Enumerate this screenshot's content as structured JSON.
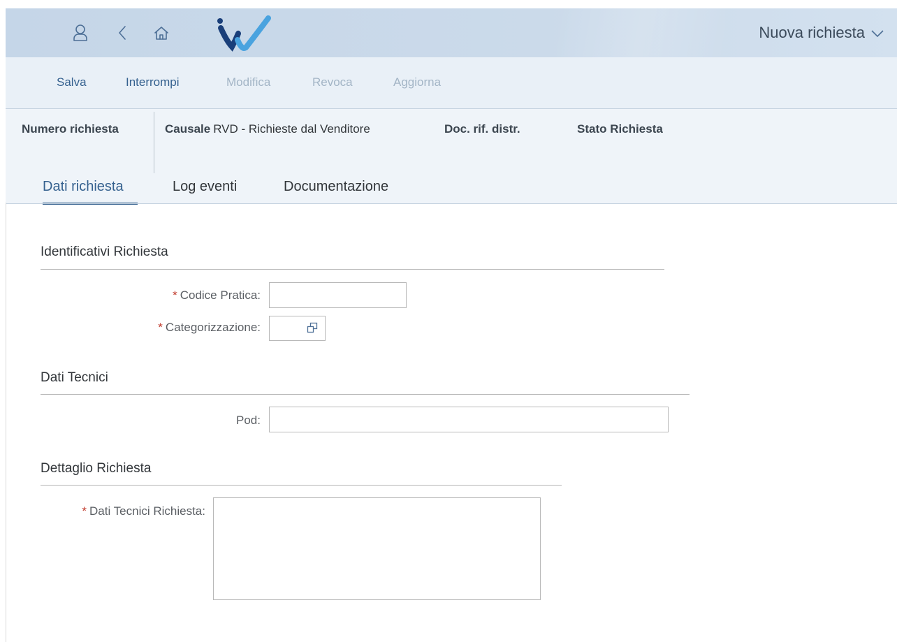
{
  "header": {
    "app_title": "Nuova richiesta",
    "icons": [
      "user-icon",
      "back-icon",
      "home-icon",
      "company-logo",
      "chevron-down-icon"
    ],
    "colors": {
      "shell_bg": "#c9d9ea",
      "icon": "#4d6f96",
      "logo_dark": "#1a3f7a",
      "logo_light": "#4aa3df"
    }
  },
  "toolbar": {
    "save": "Salva",
    "interrupt": "Interrompi",
    "edit": "Modifica",
    "revoke": "Revoca",
    "refresh": "Aggiorna",
    "colors": {
      "enabled": "#35618f",
      "disabled": "#a3b5c6"
    }
  },
  "object_header": {
    "request_number_label": "Numero richiesta",
    "cause_label": "Causale",
    "cause_value": "RVD - Richieste dal Venditore",
    "doc_ref_label": "Doc. rif. distr.",
    "status_label": "Stato Richiesta"
  },
  "tabs": [
    {
      "label": "Dati richiesta",
      "selected": true
    },
    {
      "label": "Log eventi",
      "selected": false
    },
    {
      "label": "Documentazione",
      "selected": false
    }
  ],
  "form": {
    "required_marker": "*",
    "sections": {
      "identifiers": {
        "title": "Identificativi Richiesta",
        "codice_pratica": {
          "label": "Codice Pratica:",
          "value": ""
        },
        "categorizzazione": {
          "label": "Categorizzazione:",
          "value": ""
        }
      },
      "technical": {
        "title": "Dati Tecnici",
        "pod": {
          "label": "Pod:",
          "value": ""
        }
      },
      "detail": {
        "title": "Dettaglio Richiesta",
        "dati_tecnici_richiesta": {
          "label": "Dati Tecnici Richiesta:",
          "value": ""
        }
      }
    }
  }
}
